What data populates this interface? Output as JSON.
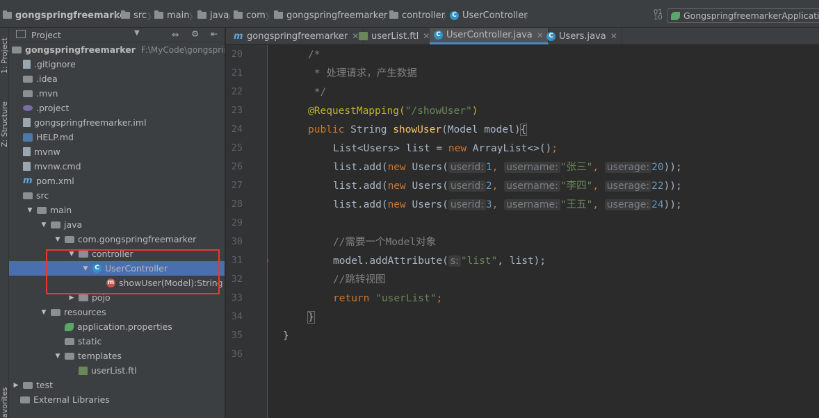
{
  "breadcrumb": {
    "items": [
      "gongspringfreemarker",
      "src",
      "main",
      "java",
      "com",
      "gongspringfreemarker",
      "controller",
      "UserController"
    ]
  },
  "run_config": {
    "label": "GongspringfreemarkerApplication"
  },
  "left_strip": {
    "project_tab": "1: Project",
    "structure_tab": "Z: Structure",
    "favorites_tab": "avorites"
  },
  "project": {
    "title": "Project",
    "root_name": "gongspringfreemarker",
    "root_path": "F:\\MyCode\\gongspringfreemarker",
    "tree": [
      {
        "label": "gongspringfreemarker",
        "icon": "folder-icon"
      },
      {
        "label": ".gitignore",
        "icon": "text-file-icon"
      },
      {
        "label": ".idea",
        "icon": "folder-icon"
      },
      {
        "label": ".mvn",
        "icon": "folder-icon"
      },
      {
        "label": ".project",
        "icon": "project-file-icon"
      },
      {
        "label": "gongspringfreemarker.iml",
        "icon": "text-file-icon"
      },
      {
        "label": "HELP.md",
        "icon": "markdown-file-icon"
      },
      {
        "label": "mvnw",
        "icon": "text-file-icon"
      },
      {
        "label": "mvnw.cmd",
        "icon": "text-file-icon"
      },
      {
        "label": "pom.xml",
        "icon": "maven-icon"
      },
      {
        "label": "src",
        "icon": "folder-icon"
      },
      {
        "label": "main",
        "icon": "folder-icon"
      },
      {
        "label": "java",
        "icon": "folder-icon"
      },
      {
        "label": "com.gongspringfreemarker",
        "icon": "package-icon"
      },
      {
        "label": "controller",
        "icon": "package-icon"
      },
      {
        "label": "UserController",
        "icon": "class-icon"
      },
      {
        "label": "showUser(Model):String",
        "icon": "method-icon"
      },
      {
        "label": "pojo",
        "icon": "package-icon"
      },
      {
        "label": "resources",
        "icon": "folder-icon"
      },
      {
        "label": "application.properties",
        "icon": "spring-leaf-icon"
      },
      {
        "label": "static",
        "icon": "folder-icon"
      },
      {
        "label": "templates",
        "icon": "folder-icon"
      },
      {
        "label": "userList.ftl",
        "icon": "ftl-file-icon"
      },
      {
        "label": "test",
        "icon": "folder-icon"
      },
      {
        "label": "External Libraries",
        "icon": "library-icon"
      }
    ]
  },
  "tabs": [
    {
      "label": "gongspringfreemarker",
      "icon": "maven-icon"
    },
    {
      "label": "userList.ftl",
      "icon": "ftl-file-icon"
    },
    {
      "label": "UserController.java",
      "icon": "class-icon",
      "active": true
    },
    {
      "label": "Users.java",
      "icon": "class-icon"
    }
  ],
  "editor": {
    "line_numbers": [
      "20",
      "21",
      "22",
      "23",
      "24",
      "25",
      "26",
      "27",
      "28",
      "29",
      "30",
      "31",
      "32",
      "33",
      "34",
      "35",
      "36"
    ],
    "code": {
      "l20": "/*",
      "l21": " * 处理请求，产生数据",
      "l22": " */",
      "l23_ann": "@RequestMapping(",
      "l23_str": "\"/showUser\"",
      "l23_end": ")",
      "l24_kw": "public",
      "l24_type": "String",
      "l24_fn": "showUser",
      "l24_rest": "(Model model)",
      "l24_brace": "{",
      "l25_a": "List<Users> list = ",
      "l25_kw": "new",
      "l25_b": " ArrayList<>()",
      "l25_semi": ";",
      "rows": [
        {
          "id": "1",
          "name": "\"张三\"",
          "age": "20"
        },
        {
          "id": "2",
          "name": "\"李四\"",
          "age": "22"
        },
        {
          "id": "3",
          "name": "\"王五\"",
          "age": "24"
        }
      ],
      "add_prefix": "list.add(",
      "new_kw": "new",
      "users_ctor": " Users(",
      "hint_userid": "userid:",
      "hint_username": "username:",
      "hint_userage": "userage:",
      "comma": ", ",
      "close": "));",
      "l30": "//需要一个Model对象",
      "l31_a": "model.addAttribute(",
      "l31_hint": "s:",
      "l31_str": "\"list\"",
      "l31_b": ", list);",
      "l32": "//跳转视图",
      "l33_kw": "return",
      "l33_str": "\"userList\"",
      "l33_semi": ";",
      "l34": "}",
      "l35": "}"
    }
  },
  "colors": {
    "selection": "#4b6eaf",
    "annotation_box": "#e53935",
    "arrow": "#e53935"
  }
}
